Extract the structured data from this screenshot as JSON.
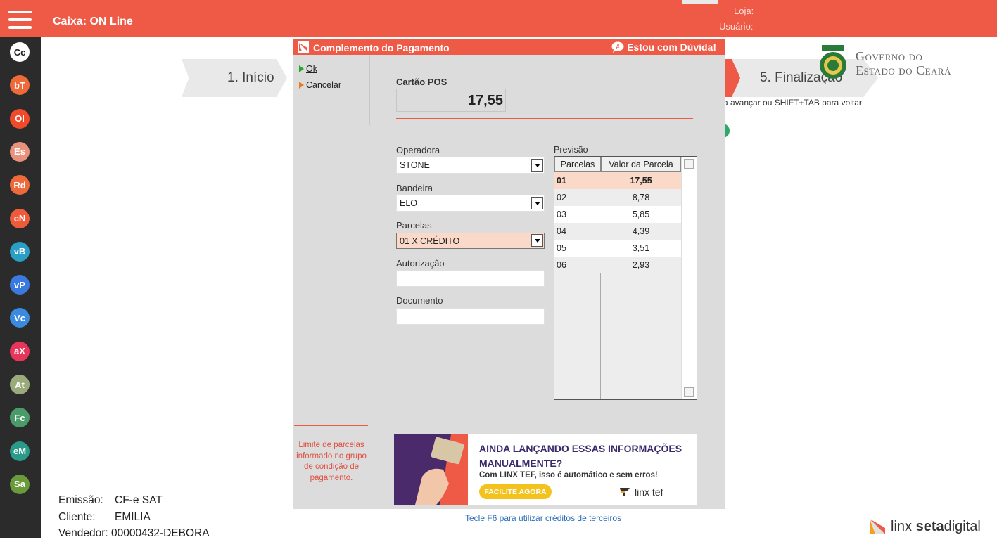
{
  "app": {
    "title": "Caixa: ON Line",
    "loja_label": "Loja:",
    "usuario_label": "Usuário:"
  },
  "sidebar": {
    "items": [
      {
        "label": "Cc",
        "color": "#ffffff",
        "text_color": "#222222"
      },
      {
        "label": "bT",
        "color": "#ef6a3a"
      },
      {
        "label": "Ol",
        "color": "#f04a2a"
      },
      {
        "label": "Es",
        "color": "#e8917c"
      },
      {
        "label": "Rd",
        "color": "#ef6a3a"
      },
      {
        "label": "cN",
        "color": "#ef5a3a"
      },
      {
        "label": "vB",
        "color": "#2a9ec4"
      },
      {
        "label": "vP",
        "color": "#3a7ae0"
      },
      {
        "label": "Vc",
        "color": "#3a8ae0"
      },
      {
        "label": "aX",
        "color": "#e8355a"
      },
      {
        "label": "At",
        "color": "#9aaa7a"
      },
      {
        "label": "Fc",
        "color": "#4a9a6a"
      },
      {
        "label": "eM",
        "color": "#2a9a8a"
      },
      {
        "label": "Sa",
        "color": "#6a9a3a"
      }
    ]
  },
  "steps": {
    "step1": "1. Início",
    "step5": "5. Finalização"
  },
  "hint": "a avançar ou SHIFT+TAB para voltar",
  "logo": {
    "line1": "Governo do",
    "line2": "Estado do Ceará"
  },
  "modal": {
    "title": "Complemento do Pagamento",
    "help": "Estou com Dúvida!",
    "actions": {
      "ok": "Ok",
      "cancel": "Cancelar"
    },
    "payment_type": "Cartão POS",
    "amount": "17,55",
    "operadora": {
      "label": "Operadora",
      "value": "STONE"
    },
    "bandeira": {
      "label": "Bandeira",
      "value": "ELO"
    },
    "parcelas": {
      "label": "Parcelas",
      "value": "01 X CRÉDITO"
    },
    "autorizacao": {
      "label": "Autorização",
      "value": ""
    },
    "documento": {
      "label": "Documento",
      "value": ""
    },
    "previsao": {
      "label": "Previsão",
      "headers": [
        "Parcelas",
        "Valor da Parcela"
      ],
      "rows": [
        {
          "n": "01",
          "v": "17,55"
        },
        {
          "n": "02",
          "v": "8,78"
        },
        {
          "n": "03",
          "v": "5,85"
        },
        {
          "n": "04",
          "v": "4,39"
        },
        {
          "n": "05",
          "v": "3,51"
        },
        {
          "n": "06",
          "v": "2,93"
        }
      ]
    },
    "note": "Limite de parcelas informado no grupo de condição de pagamento.",
    "banner": {
      "title": "AINDA LANÇANDO ESSAS INFORMAÇÕES MANUALMENTE?",
      "subtitle": "Com LINX TEF, isso é automático e sem erros!",
      "button": "FACILITE AGORA",
      "brand": "linx tef"
    }
  },
  "footer": {
    "emissao_label": "Emissão:",
    "emissao": "CF-e SAT",
    "cliente_label": "Cliente:",
    "cliente": "EMILIA",
    "vendedor_label": "Vendedor:",
    "vendedor": "00000432-DEBORA",
    "f6": "Tecle F6 para utilizar créditos de terceiros",
    "brand_a": "linx ",
    "brand_b": "seta",
    "brand_c": "digital"
  }
}
